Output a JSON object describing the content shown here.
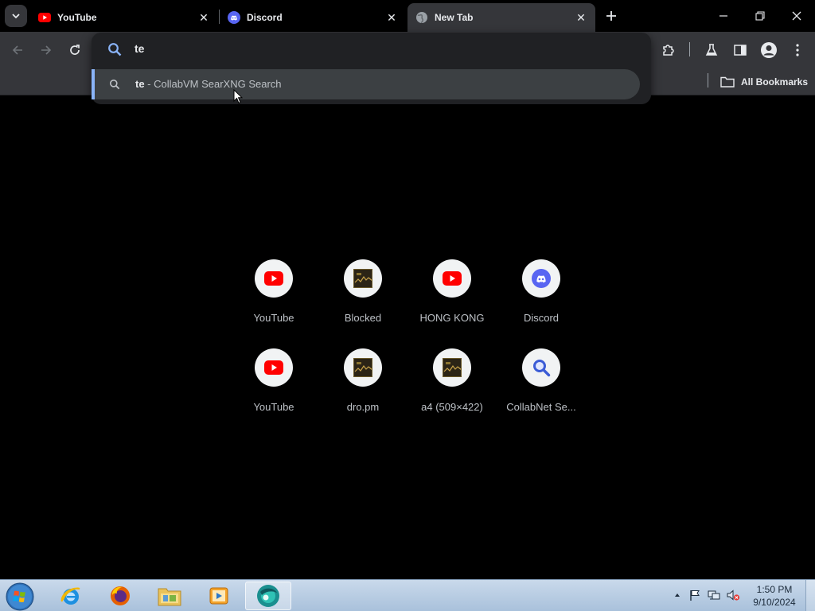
{
  "tabs": [
    {
      "title": "YouTube",
      "icon": "youtube-icon"
    },
    {
      "title": "Discord",
      "icon": "discord-icon"
    },
    {
      "title": "New Tab",
      "icon": "globe-icon",
      "active": true
    }
  ],
  "omnibox": {
    "query": "te",
    "suggestion": {
      "query": "te",
      "suffix": " - CollabVM SearXNG Search"
    }
  },
  "bookmarks": {
    "all_label": "All Bookmarks"
  },
  "shortcuts": [
    {
      "label": "YouTube",
      "icon": "youtube-icon"
    },
    {
      "label": "Blocked",
      "icon": "thumbnail-icon"
    },
    {
      "label": "HONG KONG",
      "icon": "youtube-icon"
    },
    {
      "label": "Discord",
      "icon": "discord-icon"
    },
    {
      "label": "YouTube",
      "icon": "youtube-icon"
    },
    {
      "label": "dro.pm",
      "icon": "thumbnail-icon"
    },
    {
      "label": "a4 (509×422)",
      "icon": "thumbnail-icon"
    },
    {
      "label": "CollabNet Se...",
      "icon": "search-icon"
    }
  ],
  "taskbar": {
    "time": "1:50 PM",
    "date": "9/10/2024"
  },
  "colors": {
    "youtube_red": "#ff0000",
    "discord_blurple": "#5865f2",
    "accent_blue": "#8ab4f8"
  }
}
